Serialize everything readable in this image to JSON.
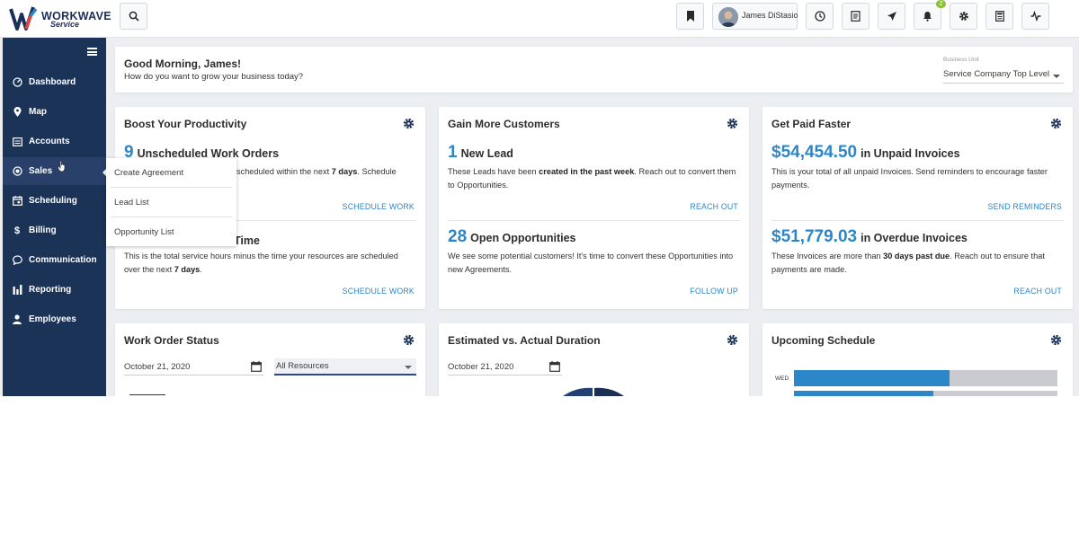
{
  "brand": {
    "name": "WORKWAVE",
    "sub": "Service"
  },
  "header": {
    "user_name": "James DiStasio",
    "notification_count": "2"
  },
  "sidebar": {
    "items": [
      {
        "label": "Dashboard",
        "icon": "dashboard-icon"
      },
      {
        "label": "Map",
        "icon": "map-pin-icon"
      },
      {
        "label": "Accounts",
        "icon": "accounts-icon"
      },
      {
        "label": "Sales",
        "icon": "sales-icon"
      },
      {
        "label": "Scheduling",
        "icon": "calendar-icon"
      },
      {
        "label": "Billing",
        "icon": "dollar-icon"
      },
      {
        "label": "Communication",
        "icon": "chat-icon"
      },
      {
        "label": "Reporting",
        "icon": "bar-chart-icon"
      },
      {
        "label": "Employees",
        "icon": "person-icon"
      }
    ],
    "sales_menu": [
      "Create Agreement",
      "Lead List",
      "Opportunity List"
    ]
  },
  "greeting": {
    "title": "Good Morning, James!",
    "subtitle": "How do you want to grow your business today?",
    "business_unit_label": "Business Unit",
    "business_unit_value": "Service Company Top Level"
  },
  "productivity": {
    "title": "Boost Your Productivity",
    "stat1_value": "9",
    "stat1_label": "Unscheduled Work Orders",
    "stat1_desc_tail": "scheduled within the next",
    "stat1_desc_bold": "7 days",
    "stat1_desc_end": ". Schedule",
    "link1": "SCHEDULE WORK",
    "stat2_label_tail": "Time",
    "stat2_desc_a": "This is the total service hours minus the time your resources are scheduled over the next",
    "stat2_desc_bold": "7 days",
    "stat2_desc_end": ".",
    "link2": "SCHEDULE WORK"
  },
  "customers": {
    "title": "Gain More Customers",
    "stat1_value": "1",
    "stat1_label": "New Lead",
    "stat1_desc_a": "These Leads have been",
    "stat1_desc_bold": "created in the past week",
    "stat1_desc_end": ". Reach out to convert them to Opportunities.",
    "link1": "REACH OUT",
    "stat2_value": "28",
    "stat2_label": "Open Opportunities",
    "stat2_desc": "We see some potential customers! It's time to convert these Opportunities into new Agreements.",
    "link2": "FOLLOW UP"
  },
  "paid": {
    "title": "Get Paid Faster",
    "stat1_value": "$54,454.50",
    "stat1_label": "in Unpaid Invoices",
    "stat1_desc": "This is your total of all unpaid Invoices. Send reminders to encourage faster payments.",
    "link1": "SEND REMINDERS",
    "stat2_value": "$51,779.03",
    "stat2_label": "in Overdue Invoices",
    "stat2_desc_a": "These Invoices are more than",
    "stat2_desc_bold": "30 days past due",
    "stat2_desc_end": ". Reach out to ensure that payments are made.",
    "link2": "REACH OUT"
  },
  "work_order_status": {
    "title": "Work Order Status",
    "date": "October 21, 2020",
    "resource": "All Resources"
  },
  "duration": {
    "title": "Estimated vs. Actual Duration",
    "date": "October 21, 2020"
  },
  "schedule": {
    "title": "Upcoming Schedule",
    "day_label": "WED",
    "bars": [
      {
        "fill_fraction": 0.59
      },
      {
        "fill_fraction": 0.53
      }
    ]
  },
  "colors": {
    "accent": "#2b87c8",
    "sidebar": "#1c3358",
    "badge": "#8dbf3a"
  }
}
